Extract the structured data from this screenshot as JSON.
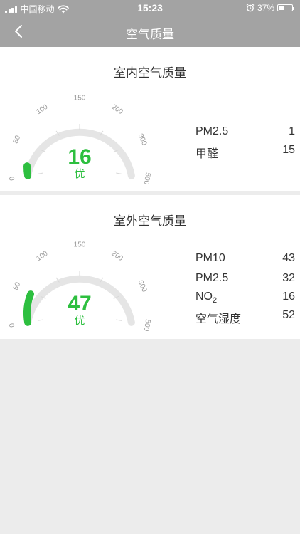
{
  "status_bar": {
    "carrier": "中国移动",
    "time": "15:23",
    "battery": "37%",
    "battery_level": 0.37
  },
  "nav": {
    "title": "空气质量",
    "back_icon": "chevron-left-icon"
  },
  "colors": {
    "accent": "#2dbf3f",
    "track": "#e5e5e5",
    "bar": "#a3a3a3"
  },
  "indoor": {
    "title": "室内空气质量",
    "value": "16",
    "level": "优",
    "scale_value": 16,
    "ticks": [
      "0",
      "50",
      "100",
      "150",
      "200",
      "300",
      "500"
    ],
    "metrics": [
      {
        "label": "PM2.5",
        "value": "1"
      },
      {
        "label": "甲醛",
        "value": "15"
      }
    ]
  },
  "outdoor": {
    "title": "室外空气质量",
    "value": "47",
    "level": "优",
    "scale_value": 47,
    "ticks": [
      "0",
      "50",
      "100",
      "150",
      "200",
      "300",
      "500"
    ],
    "metrics": [
      {
        "label": "PM10",
        "value": "43"
      },
      {
        "label": "PM2.5",
        "value": "32"
      },
      {
        "label": "NO",
        "sub": "2",
        "value": "16"
      },
      {
        "label": "空气湿度",
        "value": "52"
      }
    ]
  }
}
